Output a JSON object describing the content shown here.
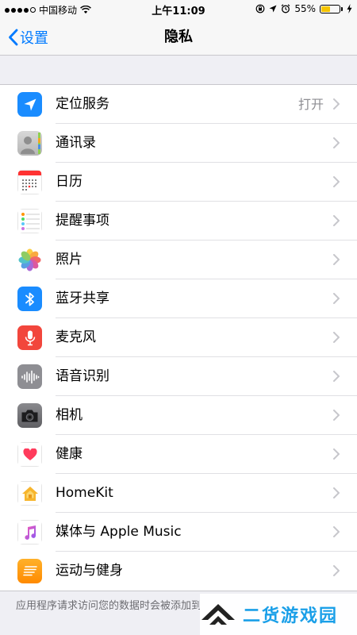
{
  "status_bar": {
    "carrier": "中国移动",
    "time": "上午11:09",
    "battery": "55%",
    "battery_level": 0.55,
    "signal_icon": "signal-dots-icon",
    "wifi_icon": "wifi-icon"
  },
  "nav": {
    "back_label": "设置",
    "title": "隐私"
  },
  "items": [
    {
      "label": "定位服务",
      "value": "打开",
      "icon": "location-icon"
    },
    {
      "label": "通讯录",
      "value": "",
      "icon": "contacts-icon"
    },
    {
      "label": "日历",
      "value": "",
      "icon": "calendar-icon"
    },
    {
      "label": "提醒事项",
      "value": "",
      "icon": "reminders-icon"
    },
    {
      "label": "照片",
      "value": "",
      "icon": "photos-icon"
    },
    {
      "label": "蓝牙共享",
      "value": "",
      "icon": "bluetooth-icon"
    },
    {
      "label": "麦克风",
      "value": "",
      "icon": "microphone-icon"
    },
    {
      "label": "语音识别",
      "value": "",
      "icon": "speech-recognition-icon"
    },
    {
      "label": "相机",
      "value": "",
      "icon": "camera-icon"
    },
    {
      "label": "健康",
      "value": "",
      "icon": "health-icon"
    },
    {
      "label": "HomeKit",
      "value": "",
      "icon": "homekit-icon"
    },
    {
      "label": "媒体与 Apple Music",
      "value": "",
      "icon": "music-icon"
    },
    {
      "label": "运动与健身",
      "value": "",
      "icon": "motion-fitness-icon"
    }
  ],
  "footer_note": "应用程序请求访问您的数据时会被添加到以上类别。",
  "watermark": {
    "text": "二货游戏园",
    "icon": "watermark-logo-icon"
  },
  "colors": {
    "accent": "#007aff",
    "background": "#efeff4",
    "battery_fill": "#f5c400"
  }
}
